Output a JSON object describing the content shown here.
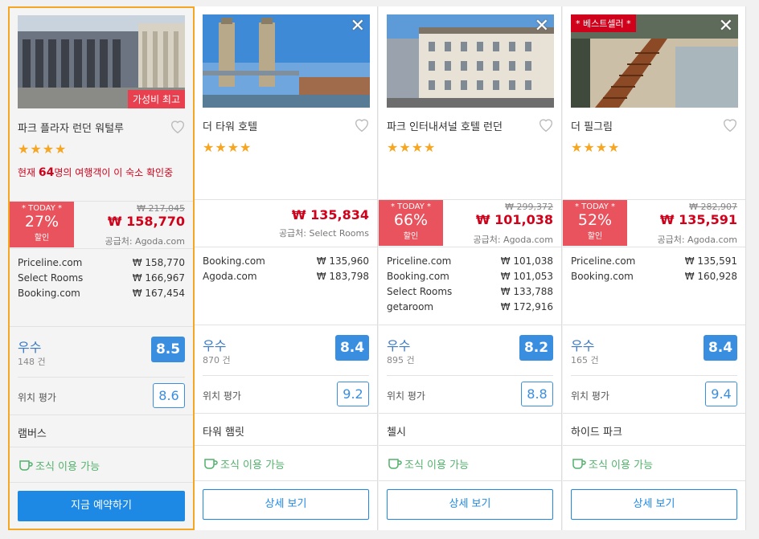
{
  "hotels": [
    {
      "name": "파크 플라자 런던 워털루",
      "badge": "가성비 최고",
      "badge_pos": "bottom",
      "stars": "★★★★",
      "viewers_prefix": "현재 ",
      "viewers_count": "64",
      "viewers_suffix": "명의 여행객이 이 숙소 확인중",
      "today_label": "* TODAY *",
      "discount": "27%",
      "discount_word": "할인",
      "original_price": "₩ 217,045",
      "price": "₩ 158,770",
      "vendor": "공급처: Agoda.com",
      "offers": [
        {
          "site": "Priceline.com",
          "price": "₩ 158,770"
        },
        {
          "site": "Select Rooms",
          "price": "₩ 166,967"
        },
        {
          "site": "Booking.com",
          "price": "₩ 167,454"
        }
      ],
      "rating_label": "우수",
      "review_count": "148 건",
      "rating_score": "8.5",
      "location_label": "위치 평가",
      "location_score": "8.6",
      "area": "램버스",
      "breakfast": "조식 이용 가능",
      "button": "지금 예약하기"
    },
    {
      "name": "더 타워 호텔",
      "stars": "★★★★",
      "price": "₩ 135,834",
      "vendor": "공급처: Select Rooms",
      "offers": [
        {
          "site": "Booking.com",
          "price": "₩ 135,960"
        },
        {
          "site": "Agoda.com",
          "price": "₩ 183,798"
        }
      ],
      "rating_label": "우수",
      "review_count": "870 건",
      "rating_score": "8.4",
      "location_label": "위치 평가",
      "location_score": "9.2",
      "area": "타워 햄릿",
      "breakfast": "조식 이용 가능",
      "button": "상세 보기"
    },
    {
      "name": "파크 인터내셔널 호텔 런던",
      "stars": "★★★★",
      "today_label": "* TODAY *",
      "discount": "66%",
      "discount_word": "할인",
      "original_price": "₩ 299,372",
      "price": "₩ 101,038",
      "vendor": "공급처: Agoda.com",
      "offers": [
        {
          "site": "Priceline.com",
          "price": "₩ 101,038"
        },
        {
          "site": "Booking.com",
          "price": "₩ 101,053"
        },
        {
          "site": "Select Rooms",
          "price": "₩ 133,788"
        },
        {
          "site": "getaroom",
          "price": "₩ 172,916"
        }
      ],
      "rating_label": "우수",
      "review_count": "895 건",
      "rating_score": "8.2",
      "location_label": "위치 평가",
      "location_score": "8.8",
      "area": "첼시",
      "breakfast": "조식 이용 가능",
      "button": "상세 보기"
    },
    {
      "name": "더 필그림",
      "badge": "* 베스트셀러 *",
      "stars": "★★★★",
      "today_label": "* TODAY *",
      "discount": "52%",
      "discount_word": "할인",
      "original_price": "₩ 282,907",
      "price": "₩ 135,591",
      "vendor": "공급처: Agoda.com",
      "offers": [
        {
          "site": "Priceline.com",
          "price": "₩ 135,591"
        },
        {
          "site": "Booking.com",
          "price": "₩ 160,928"
        }
      ],
      "rating_label": "우수",
      "review_count": "165 건",
      "rating_score": "8.4",
      "location_label": "위치 평가",
      "location_score": "9.4",
      "area": "하이드 파크",
      "breakfast": "조식 이용 가능",
      "button": "상세 보기"
    }
  ],
  "close_glyph": "✕",
  "colors": {
    "accent": "#1e88e5",
    "discount": "#e8535d",
    "price": "#d0021b",
    "rating": "#3a8ee0",
    "selected_border": "#f5a623",
    "breakfast": "#52b26b"
  }
}
